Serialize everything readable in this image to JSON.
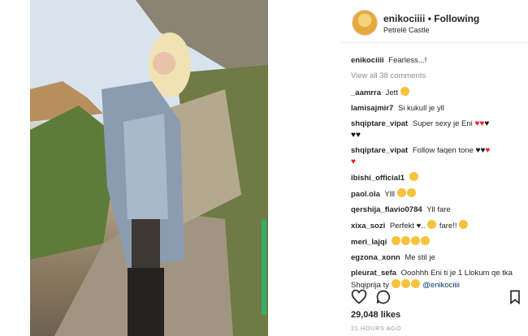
{
  "header": {
    "username": "enikociiii",
    "separator": "•",
    "follow_label": "Following",
    "location": "Petrelë Castle"
  },
  "caption": {
    "username": "enikociiii",
    "text": "Fearless...!"
  },
  "view_all": "View all 38 comments",
  "comments": [
    {
      "user": "_aamrra",
      "text": "Jett"
    },
    {
      "user": "lamisajmir7",
      "text": "Si kukull je yll"
    },
    {
      "user": "shqiptare_vipat",
      "text": "Super sexy je Eni"
    },
    {
      "user": "shqiptare_vipat",
      "text": "Follow faqen tone"
    },
    {
      "user": "ibishi_official1",
      "text": ""
    },
    {
      "user": "paol.ola",
      "text": "Ylll"
    },
    {
      "user": "qershija_flavio0784",
      "text": "Yll fare"
    },
    {
      "user": "xixa_sozi",
      "text": "Perfekt ♥..",
      "text2": "fare!!"
    },
    {
      "user": "meri_lajqi",
      "text": ""
    },
    {
      "user": "egzona_xonn",
      "text": "Me stil je"
    },
    {
      "user": "pleurat_sefa",
      "text": "Ooohhh Eni ti je 1 Llokum qe tka Shqiprija ty",
      "mention": "@enikociiii"
    }
  ],
  "likes": "29,048 likes",
  "time": "21 HOURS AGO",
  "colors": {
    "heart": "#ed1c24",
    "mention": "#003569",
    "muted": "#8e8e8e"
  },
  "icons": [
    "heart-icon",
    "comment-icon",
    "bookmark-icon"
  ]
}
